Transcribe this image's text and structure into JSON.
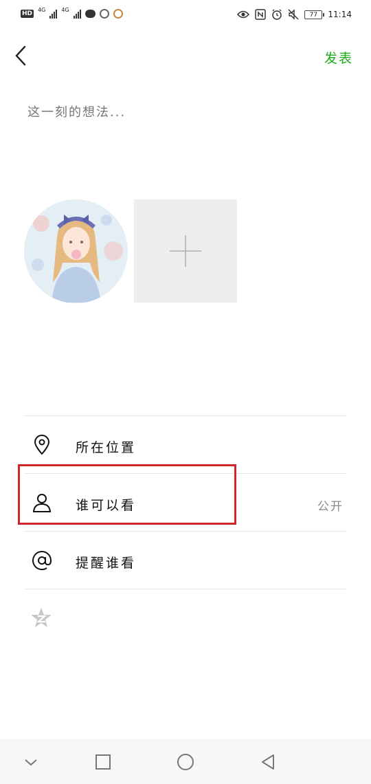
{
  "status_bar": {
    "hd_label": "HD",
    "network_1": "4G",
    "network_2": "4G",
    "battery_level": "77",
    "time": "11:14"
  },
  "header": {
    "publish_label": "发表"
  },
  "composer": {
    "placeholder": "这一刻的想法..."
  },
  "options": [
    {
      "label": "所在位置",
      "icon": "location-pin-icon",
      "value": ""
    },
    {
      "label": "谁可以看",
      "icon": "person-icon",
      "value": "公开"
    },
    {
      "label": "提醒谁看",
      "icon": "at-sign-icon",
      "value": ""
    }
  ],
  "colors": {
    "accent_green": "#1aad19",
    "highlight_red": "#d0262d",
    "placeholder_gray": "#bdbdbd"
  },
  "navbar": {
    "icons": [
      "chevron-down-icon",
      "square-icon",
      "circle-icon",
      "triangle-back-icon"
    ]
  }
}
